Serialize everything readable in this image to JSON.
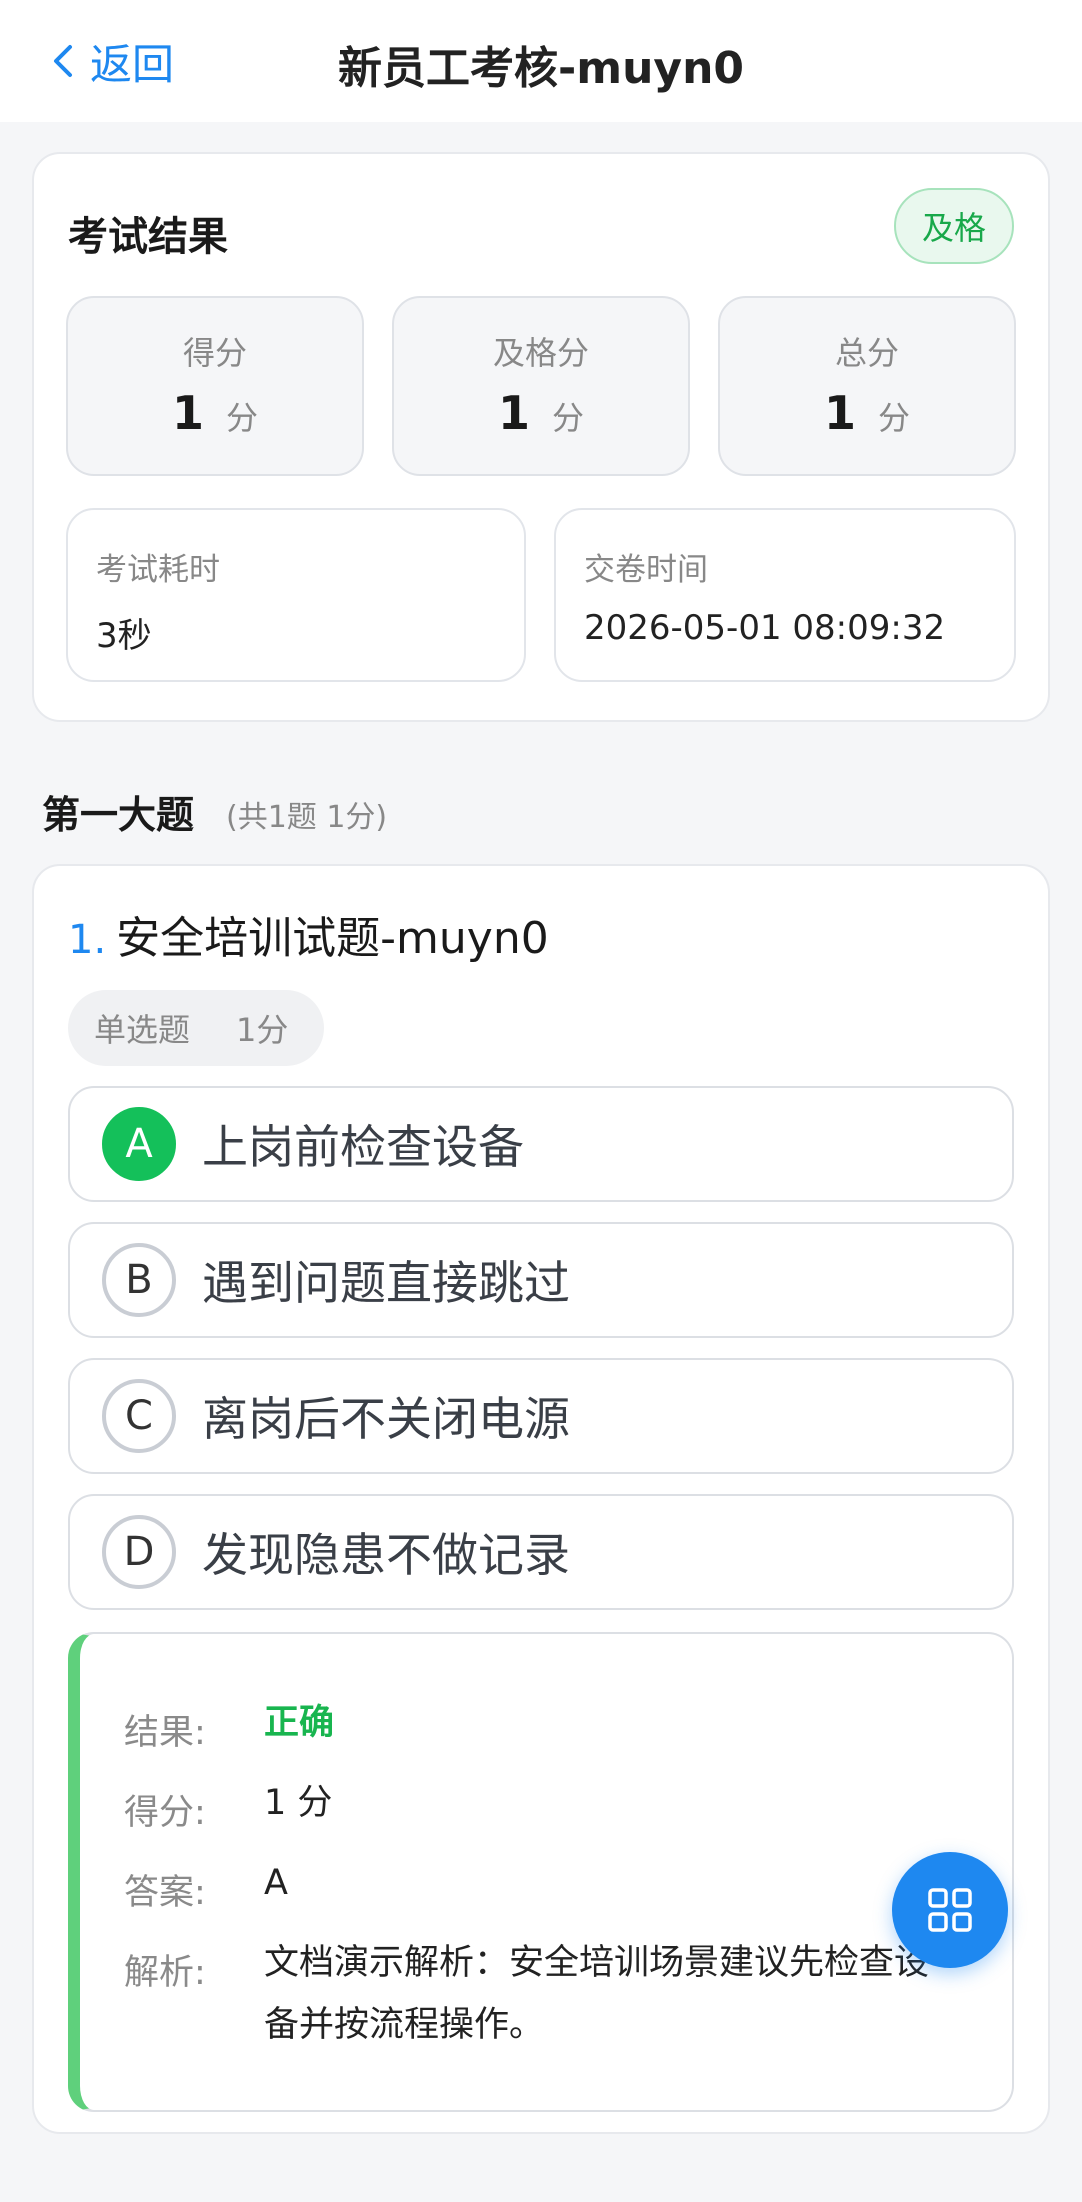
{
  "header": {
    "back_label": "返回",
    "title": "新员工考核-muyn0"
  },
  "result": {
    "title": "考试结果",
    "status": "及格",
    "stats": [
      {
        "label": "得分",
        "value": "1",
        "unit": "分"
      },
      {
        "label": "及格分",
        "value": "1",
        "unit": "分"
      },
      {
        "label": "总分",
        "value": "1",
        "unit": "分"
      }
    ],
    "duration_label": "考试耗时",
    "duration_value": "3秒",
    "submit_label": "交卷时间",
    "submit_value": "2026-05-01 08:09:32"
  },
  "section": {
    "title": "第一大题",
    "meta": "(共1题 1分)"
  },
  "question": {
    "number": "1.",
    "text": "安全培训试题-muyn0",
    "type": "单选题",
    "score": "1分",
    "options": [
      {
        "letter": "A",
        "text": "上岗前检查设备",
        "selected": true
      },
      {
        "letter": "B",
        "text": "遇到问题直接跳过",
        "selected": false
      },
      {
        "letter": "C",
        "text": "离岗后不关闭电源",
        "selected": false
      },
      {
        "letter": "D",
        "text": "发现隐患不做记录",
        "selected": false
      }
    ],
    "analysis": {
      "result_label": "结果:",
      "result_value": "正确",
      "score_label": "得分:",
      "score_value": "1 分",
      "answer_label": "答案:",
      "answer_value": "A",
      "explain_label": "解析:",
      "explain_value": "文档演示解析：安全培训场景建议先检查设备并按流程操作。"
    }
  },
  "colors": {
    "primary": "#1e88f0",
    "success": "#14c05a",
    "background": "#f5f6f8"
  },
  "icons": {
    "back": "chevron-left-icon",
    "fab": "grid-icon"
  }
}
